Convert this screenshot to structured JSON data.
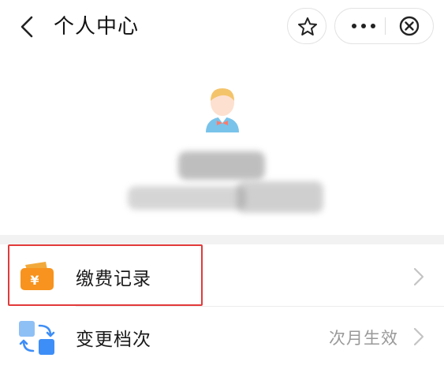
{
  "header": {
    "back_icon": "chevron-left-icon",
    "title": "个人中心",
    "favorite_icon": "star-icon",
    "more_icon": "more-dots-icon",
    "close_icon": "close-circle-icon"
  },
  "profile": {
    "avatar_icon": "user-avatar-icon"
  },
  "menu": [
    {
      "label": "缴费记录",
      "icon": "wallet-yuan-icon",
      "value": "",
      "accent": "#f5a623"
    },
    {
      "label": "变更档次",
      "icon": "switch-blocks-icon",
      "value": "次月生效",
      "accent": "#3e8ef7"
    }
  ],
  "colors": {
    "highlight": "#e23a3a",
    "muted": "#999999"
  }
}
